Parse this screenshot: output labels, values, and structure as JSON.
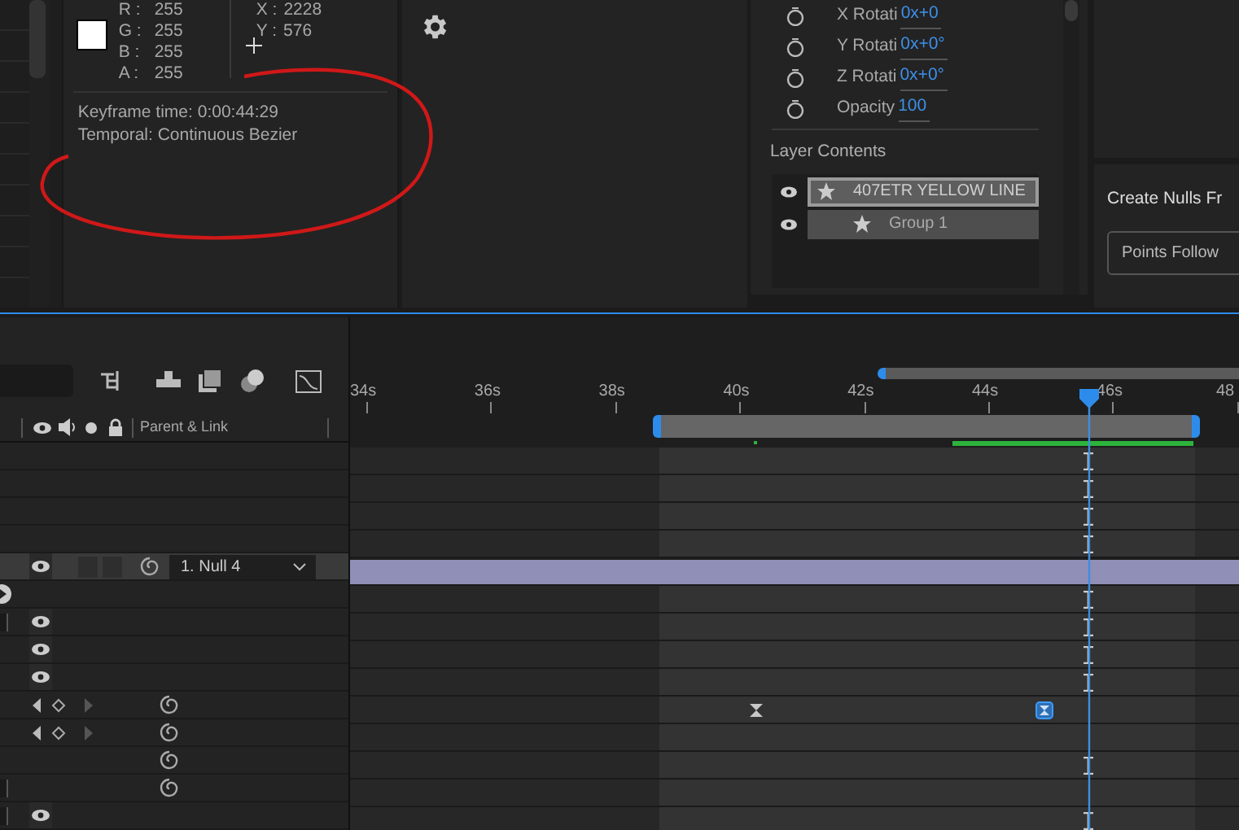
{
  "info": {
    "channels": [
      {
        "label": "R :",
        "value": "255"
      },
      {
        "label": "G :",
        "value": "255"
      },
      {
        "label": "B :",
        "value": "255"
      },
      {
        "label": "A :",
        "value": "255"
      }
    ],
    "coords": [
      {
        "label": "X :",
        "value": "2228"
      },
      {
        "label": "Y :",
        "value": "576"
      }
    ],
    "lines": [
      "Keyframe time: 0:00:44:29",
      "Temporal: Continuous Bezier"
    ]
  },
  "transform": {
    "properties": [
      {
        "label": "X Rotati",
        "value": "0x+0"
      },
      {
        "label": "Y Rotati",
        "value": "0x+0°"
      },
      {
        "label": "Z Rotati",
        "value": "0x+0°"
      },
      {
        "label": "Opacity",
        "value": "100"
      }
    ]
  },
  "layer_contents": {
    "title": "Layer Contents",
    "items": [
      {
        "label": "407ETR YELLOW LINE",
        "selected": true,
        "children": [
          {
            "label": "Group 1",
            "selected": false
          }
        ]
      }
    ]
  },
  "create_nulls": {
    "title": "Create Nulls Fr",
    "button": "Points Follow"
  },
  "timeline": {
    "header": "Parent & Link",
    "ticks": [
      "34s",
      "36s",
      "38s",
      "40s",
      "42s",
      "44s",
      "46s",
      "48"
    ],
    "rows": [
      {
        "kind": "blank",
        "eye": false,
        "checkbox": false,
        "keyframe_nav": false,
        "pickwhip": false,
        "marker": true,
        "keyframes": []
      },
      {
        "kind": "blank",
        "eye": false,
        "checkbox": false,
        "keyframe_nav": false,
        "pickwhip": false,
        "marker": true,
        "keyframes": []
      },
      {
        "kind": "blank",
        "eye": false,
        "checkbox": false,
        "keyframe_nav": false,
        "pickwhip": false,
        "marker": true,
        "keyframes": []
      },
      {
        "kind": "blank",
        "eye": false,
        "checkbox": false,
        "keyframe_nav": false,
        "pickwhip": false,
        "marker": true,
        "keyframes": []
      },
      {
        "kind": "layer",
        "parent": "1. Null 4",
        "eye": true,
        "checkbox": false,
        "keyframe_nav": false,
        "pickwhip": true,
        "marker": false,
        "keyframes": []
      },
      {
        "kind": "twirl",
        "eye": false,
        "checkbox": false,
        "keyframe_nav": false,
        "pickwhip": false,
        "marker": true,
        "keyframes": []
      },
      {
        "kind": "property",
        "eye": true,
        "checkbox": true,
        "keyframe_nav": false,
        "pickwhip": false,
        "marker": true,
        "keyframes": []
      },
      {
        "kind": "property",
        "eye": true,
        "checkbox": false,
        "keyframe_nav": false,
        "pickwhip": false,
        "marker": true,
        "keyframes": []
      },
      {
        "kind": "property",
        "eye": true,
        "checkbox": false,
        "keyframe_nav": false,
        "pickwhip": false,
        "marker": true,
        "keyframes": []
      },
      {
        "kind": "property",
        "eye": false,
        "checkbox": false,
        "keyframe_nav": true,
        "pickwhip": true,
        "marker": false,
        "keyframes": [
          {
            "selected": false
          },
          {
            "selected": true
          }
        ]
      },
      {
        "kind": "property",
        "eye": false,
        "checkbox": false,
        "keyframe_nav": true,
        "pickwhip": true,
        "marker": false,
        "keyframes": []
      },
      {
        "kind": "property",
        "eye": false,
        "checkbox": false,
        "keyframe_nav": false,
        "pickwhip": true,
        "marker": true,
        "keyframes": []
      },
      {
        "kind": "property",
        "eye": false,
        "checkbox": true,
        "keyframe_nav": false,
        "pickwhip": true,
        "marker": false,
        "keyframes": []
      },
      {
        "kind": "property",
        "eye": true,
        "checkbox": true,
        "keyframe_nav": false,
        "pickwhip": false,
        "marker": true,
        "keyframes": []
      }
    ]
  }
}
